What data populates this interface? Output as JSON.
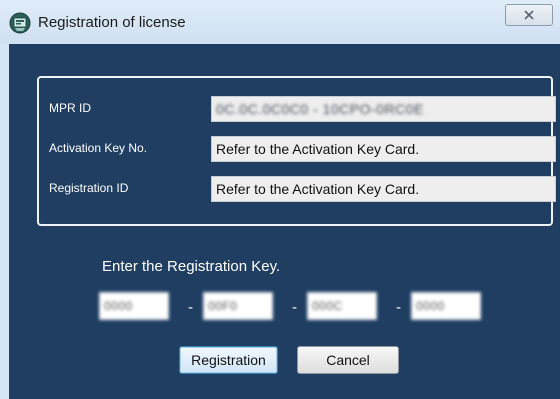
{
  "window": {
    "title": "Registration of license",
    "close_icon": "close-icon",
    "app_icon": "license-app-icon"
  },
  "info": {
    "mpr_id_label": "MPR ID",
    "mpr_id_value": "0C.0C.0C0C0 - 10CPO-0RC0E",
    "activation_label": "Activation Key No.",
    "activation_value": "Refer to the Activation Key Card.",
    "registration_id_label": "Registration ID",
    "registration_id_value": "Refer to the Activation Key Card."
  },
  "key_entry": {
    "prompt": "Enter the Registration Key.",
    "separator": "-",
    "segments": [
      "0000",
      "00F0",
      "000C",
      "0000"
    ]
  },
  "buttons": {
    "register": "Registration",
    "cancel": "Cancel"
  },
  "colors": {
    "background": "#1f3e61",
    "frame": "#d6e5f5",
    "field": "#eeeeee"
  }
}
